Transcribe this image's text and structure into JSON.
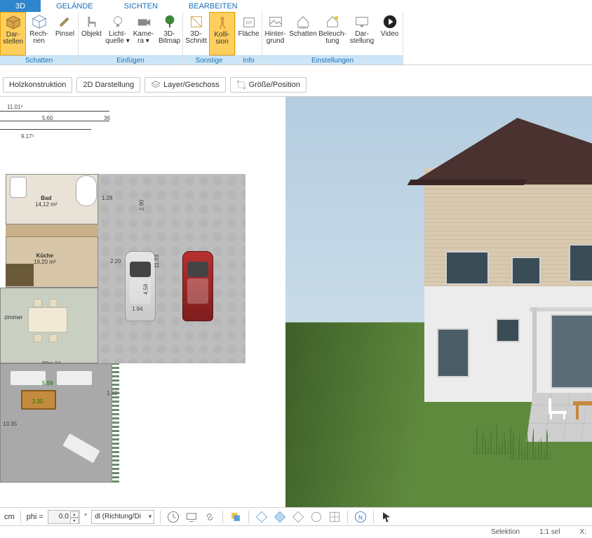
{
  "tabs": {
    "items": [
      {
        "label": "3D",
        "active": true
      },
      {
        "label": "GELÄNDE",
        "active": false
      },
      {
        "label": "SICHTEN",
        "active": false
      },
      {
        "label": "BEARBEITEN",
        "active": false
      }
    ]
  },
  "ribbon": {
    "groups": [
      {
        "label": "Schatten",
        "buttons": [
          {
            "id": "darstellen",
            "line1": "Dar-",
            "line2": "stellen",
            "selected": true,
            "icon": "cube"
          },
          {
            "id": "rechnen",
            "line1": "Rech-",
            "line2": "nen",
            "icon": "cube-wire"
          },
          {
            "id": "pinsel",
            "line1": "Pinsel",
            "line2": "",
            "icon": "brush"
          }
        ]
      },
      {
        "label": "Einfügen",
        "buttons": [
          {
            "id": "objekt",
            "line1": "Objekt",
            "line2": "",
            "icon": "chair"
          },
          {
            "id": "lichtquelle",
            "line1": "Licht-",
            "line2": "quelle ▾",
            "icon": "bulb"
          },
          {
            "id": "kamera",
            "line1": "Kame-",
            "line2": "ra ▾",
            "icon": "camera"
          },
          {
            "id": "bitmap3d",
            "line1": "3D-",
            "line2": "Bitmap",
            "icon": "tree"
          }
        ]
      },
      {
        "label": "Sonstige",
        "buttons": [
          {
            "id": "schnitt3d",
            "line1": "3D-",
            "line2": "Schnitt",
            "icon": "slice"
          },
          {
            "id": "kollision",
            "line1": "Kolli-",
            "line2": "sion",
            "selected": true,
            "icon": "person"
          }
        ]
      },
      {
        "label": "Info",
        "buttons": [
          {
            "id": "flaeche",
            "line1": "Fläche",
            "line2": "",
            "icon": "area"
          }
        ]
      },
      {
        "label": "Einstellungen",
        "buttons": [
          {
            "id": "hintergrund",
            "line1": "Hinter-",
            "line2": "grund",
            "icon": "picture"
          },
          {
            "id": "schatten2",
            "line1": "Schatten",
            "line2": "",
            "icon": "house-shadow"
          },
          {
            "id": "beleuchtung",
            "line1": "Beleuch-",
            "line2": "tung",
            "icon": "house-light"
          },
          {
            "id": "darstellung",
            "line1": "Dar-",
            "line2": "stellung",
            "icon": "monitor"
          },
          {
            "id": "video",
            "line1": "Video",
            "line2": "",
            "icon": "play"
          }
        ]
      }
    ]
  },
  "toolbar2": {
    "buttons": [
      {
        "id": "holz",
        "label": "Holzkonstruktion"
      },
      {
        "id": "darst2d",
        "label": "2D Darstellung"
      },
      {
        "id": "layer",
        "label": "Layer/Geschoss",
        "icon": "layers"
      },
      {
        "id": "groesse",
        "label": "Größe/Position",
        "icon": "resize"
      }
    ]
  },
  "plan": {
    "dims": {
      "top1": "11.01⁵",
      "top2": "5.60",
      "top3": "36",
      "bottom1": "9.17⁵",
      "zimmer_left": "10.35",
      "drive_r": "2.90",
      "drive_w": "2.20",
      "drive_h": "11.03",
      "car_h": "4.58",
      "car_w": "1.94",
      "room_w1": "89m 24",
      "room_w2": "5.99",
      "rug": "2.35",
      "balk1": "1.32⁵",
      "balk2": "1.28"
    },
    "rooms": {
      "bad": {
        "name": "Bad",
        "area": "14,12 m²"
      },
      "kueche": {
        "name": "Küche",
        "area": "19,20 m²"
      },
      "zimmer": {
        "name": "zimmer",
        "area": ""
      }
    }
  },
  "bottombar": {
    "unit": "cm",
    "phi_label": "phi =",
    "phi_value": "0.0",
    "deg": "°",
    "mode": "dl (Richtung/Di"
  },
  "statusbar": {
    "selektion": "Selektion",
    "scale": "1:1 sel",
    "x": "X:"
  }
}
